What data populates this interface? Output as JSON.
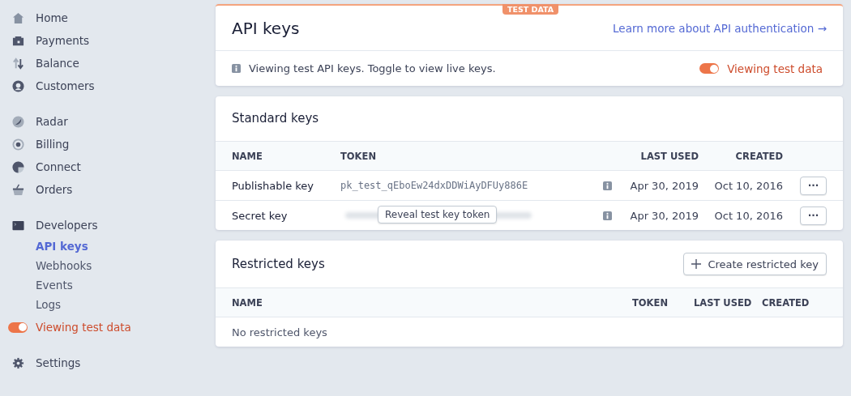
{
  "sidebar": {
    "groups": [
      {
        "items": [
          {
            "label": "Home",
            "kind": "home"
          },
          {
            "label": "Payments",
            "kind": "payments"
          },
          {
            "label": "Balance",
            "kind": "balance"
          },
          {
            "label": "Customers",
            "kind": "customers"
          }
        ]
      },
      {
        "items": [
          {
            "label": "Radar",
            "kind": "radar"
          },
          {
            "label": "Billing",
            "kind": "billing"
          },
          {
            "label": "Connect",
            "kind": "connect"
          },
          {
            "label": "Orders",
            "kind": "orders"
          }
        ]
      },
      {
        "items": [
          {
            "label": "Developers",
            "kind": "terminal",
            "children": [
              {
                "label": "API keys",
                "selected": true
              },
              {
                "label": "Webhooks",
                "selected": false
              },
              {
                "label": "Events",
                "selected": false
              },
              {
                "label": "Logs",
                "selected": false
              }
            ]
          }
        ]
      }
    ],
    "test_toggle": {
      "label": "Viewing test data",
      "on": true
    },
    "settings": {
      "label": "Settings",
      "kind": "settings"
    }
  },
  "header_card": {
    "badge": "TEST DATA",
    "title": "API keys",
    "link": "Learn more about API authentication →",
    "notice": "Viewing test API keys. Toggle to view live keys.",
    "toggle": {
      "label": "Viewing test data",
      "on": true
    }
  },
  "standard_keys": {
    "title": "Standard keys",
    "columns": [
      "NAME",
      "TOKEN",
      "LAST USED",
      "CREATED"
    ],
    "rows": [
      {
        "name": "Publishable key",
        "token": "pk_test_qEboEw24dxDDWiAyDFUy886E",
        "hidden": false,
        "last_used": "Apr 30, 2019",
        "created": "Oct 10, 2016",
        "menu": "···"
      },
      {
        "name": "Secret key",
        "hidden": true,
        "reveal_tooltip": "Reveal test key token",
        "last_used": "Apr 30, 2019",
        "created": "Oct 10, 2016",
        "menu": "···"
      }
    ]
  },
  "restricted_keys": {
    "title": "Restricted keys",
    "create_button": "Create restricted key",
    "columns": [
      "NAME",
      "TOKEN",
      "LAST USED",
      "CREATED"
    ],
    "empty": "No restricted keys"
  }
}
